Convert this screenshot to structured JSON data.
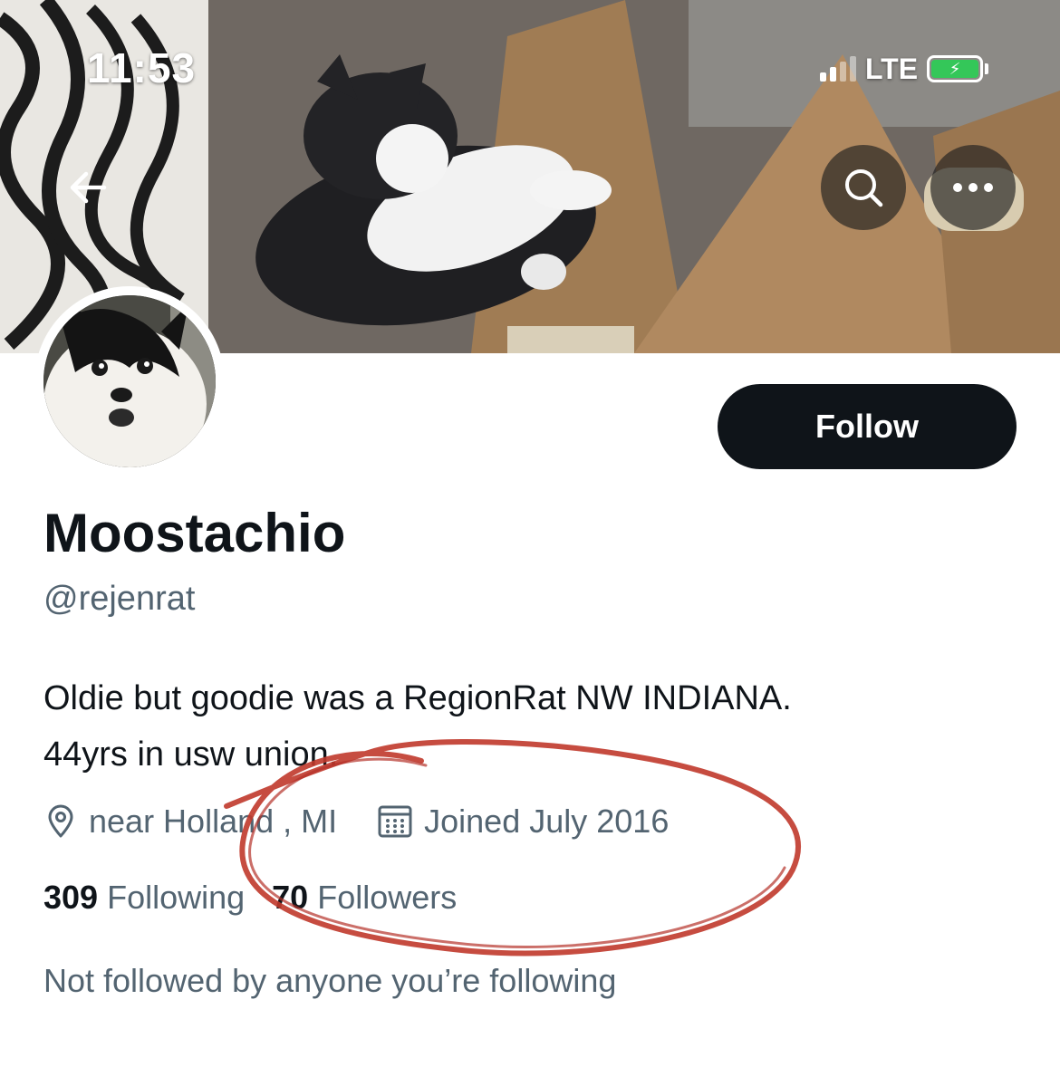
{
  "status_bar": {
    "time": "11:53",
    "network": "LTE",
    "battery_charging": true
  },
  "header": {
    "back_icon": "arrow-left-icon",
    "search_icon": "search-icon",
    "more_icon": "more-horizontal-icon"
  },
  "profile": {
    "display_name": "Moostachio",
    "handle": "@rejenrat",
    "bio_line1": "Oldie but goodie was a RegionRat NW INDIANA.",
    "bio_line2": "44yrs in usw union.",
    "location": "near Holland , MI",
    "joined": "Joined July 2016",
    "following_count": "309",
    "following_label": "Following",
    "followers_count": "70",
    "followers_label": "Followers",
    "followed_note": "Not followed by anyone you’re following"
  },
  "actions": {
    "follow_label": "Follow"
  },
  "colors": {
    "primary_text": "#0f1419",
    "secondary_text": "#536471",
    "follow_button": "#0f1419",
    "annotation": "#c0392b",
    "battery": "#34c759"
  }
}
